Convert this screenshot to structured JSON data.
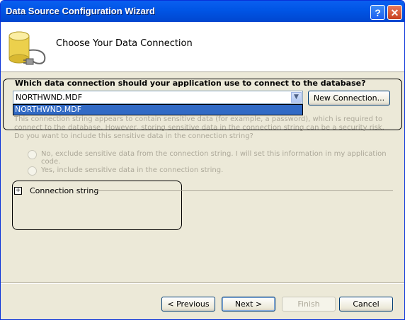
{
  "window": {
    "title": "Data Source Configuration Wizard",
    "help_glyph": "?",
    "close_glyph": "✕"
  },
  "header": {
    "title": "Choose Your Data Connection"
  },
  "connection": {
    "question": "Which data connection should your application use to connect to the database?",
    "selected": "NORTHWND.MDF",
    "options": [
      "NORTHWND.MDF"
    ],
    "new_button": "New Connection..."
  },
  "sensitive": {
    "info": "This connection string appears to contain sensitive data (for example, a password), which is required to connect to the database. However, storing sensitive data in the connection string can be a security risk. Do you want to include this sensitive data in the connection string?",
    "option_exclude": "No, exclude sensitive data from the connection string. I will set this information in my application code.",
    "option_include": "Yes, include sensitive data in the connection string."
  },
  "connection_string": {
    "label": "Connection string",
    "expander": "+"
  },
  "footer": {
    "previous": "< Previous",
    "next": "Next >",
    "finish": "Finish",
    "cancel": "Cancel"
  }
}
